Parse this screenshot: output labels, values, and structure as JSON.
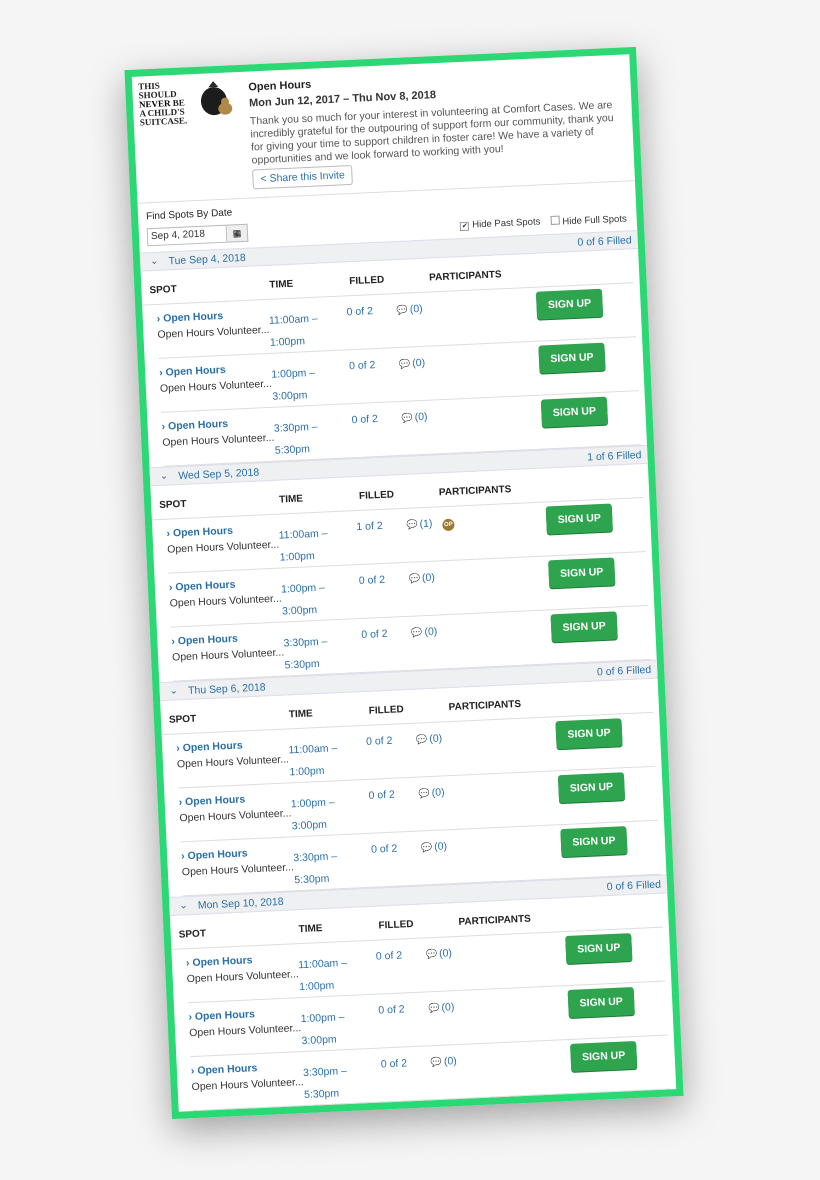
{
  "event": {
    "logo": {
      "line1": "THIS SHOULD",
      "line2": "NEVER",
      "line2b": "BE",
      "line3": "A CHILD'S",
      "line4": "SUITCASE."
    },
    "title": "Open Hours",
    "dates": "Mon Jun 12, 2017 – Thu Nov 8, 2018",
    "description": "Thank you so much for your interest in volunteering at Comfort Cases. We are incredibly grateful for the outpouring of support form our community, thank you for giving your time to support children in foster care! We have a variety of opportunities and we look forward to working with you!",
    "share_label": "Share this Invite"
  },
  "filters": {
    "find_label": "Find Spots By Date",
    "date_value": "Sep 4, 2018",
    "hide_past": "Hide Past Spots",
    "hide_full": "Hide Full Spots"
  },
  "columns": {
    "spot": "SPOT",
    "time": "TIME",
    "filled": "FILLED",
    "participants": "PARTICIPANTS"
  },
  "days": [
    {
      "date": "Tue Sep 4, 2018",
      "filled": "0 of 6 Filled",
      "rows": [
        {
          "name": "Open Hours",
          "desc": "Open Hours Volunteer...",
          "time1": "11:00am –",
          "time2": "1:00pm",
          "filled": "0 of 2",
          "comments": "(0)",
          "button": "SIGN UP"
        },
        {
          "name": "Open Hours",
          "desc": "Open Hours Volunteer...",
          "time1": "1:00pm –",
          "time2": "3:00pm",
          "filled": "0 of 2",
          "comments": "(0)",
          "button": "SIGN UP"
        },
        {
          "name": "Open Hours",
          "desc": "Open Hours Volunteer...",
          "time1": "3:30pm –",
          "time2": "5:30pm",
          "filled": "0 of 2",
          "comments": "(0)",
          "button": "SIGN UP"
        }
      ]
    },
    {
      "date": "Wed Sep 5, 2018",
      "filled": "1 of 6 Filled",
      "rows": [
        {
          "name": "Open Hours",
          "desc": "Open Hours Volunteer...",
          "time1": "11:00am –",
          "time2": "1:00pm",
          "filled": "1 of 2",
          "comments": "(1)",
          "avatar": "OP",
          "button": "SIGN UP"
        },
        {
          "name": "Open Hours",
          "desc": "Open Hours Volunteer...",
          "time1": "1:00pm –",
          "time2": "3:00pm",
          "filled": "0 of 2",
          "comments": "(0)",
          "button": "SIGN UP"
        },
        {
          "name": "Open Hours",
          "desc": "Open Hours Volunteer...",
          "time1": "3:30pm –",
          "time2": "5:30pm",
          "filled": "0 of 2",
          "comments": "(0)",
          "button": "SIGN UP"
        }
      ]
    },
    {
      "date": "Thu Sep 6, 2018",
      "filled": "0 of 6 Filled",
      "rows": [
        {
          "name": "Open Hours",
          "desc": "Open Hours Volunteer...",
          "time1": "11:00am –",
          "time2": "1:00pm",
          "filled": "0 of 2",
          "comments": "(0)",
          "button": "SIGN UP"
        },
        {
          "name": "Open Hours",
          "desc": "Open Hours Volunteer...",
          "time1": "1:00pm –",
          "time2": "3:00pm",
          "filled": "0 of 2",
          "comments": "(0)",
          "button": "SIGN UP"
        },
        {
          "name": "Open Hours",
          "desc": "Open Hours Volunteer...",
          "time1": "3:30pm –",
          "time2": "5:30pm",
          "filled": "0 of 2",
          "comments": "(0)",
          "button": "SIGN UP"
        }
      ]
    },
    {
      "date": "Mon Sep 10, 2018",
      "filled": "0 of 6 Filled",
      "rows": [
        {
          "name": "Open Hours",
          "desc": "Open Hours Volunteer...",
          "time1": "11:00am –",
          "time2": "1:00pm",
          "filled": "0 of 2",
          "comments": "(0)",
          "button": "SIGN UP"
        },
        {
          "name": "Open Hours",
          "desc": "Open Hours Volunteer...",
          "time1": "1:00pm –",
          "time2": "3:00pm",
          "filled": "0 of 2",
          "comments": "(0)",
          "button": "SIGN UP"
        },
        {
          "name": "Open Hours",
          "desc": "Open Hours Volunteer...",
          "time1": "3:30pm –",
          "time2": "5:30pm",
          "filled": "0 of 2",
          "comments": "(0)",
          "button": "SIGN UP"
        }
      ]
    }
  ],
  "colors": {
    "frame": "#2bd873",
    "accent": "#2a6fa8",
    "button": "#2ea44f"
  }
}
